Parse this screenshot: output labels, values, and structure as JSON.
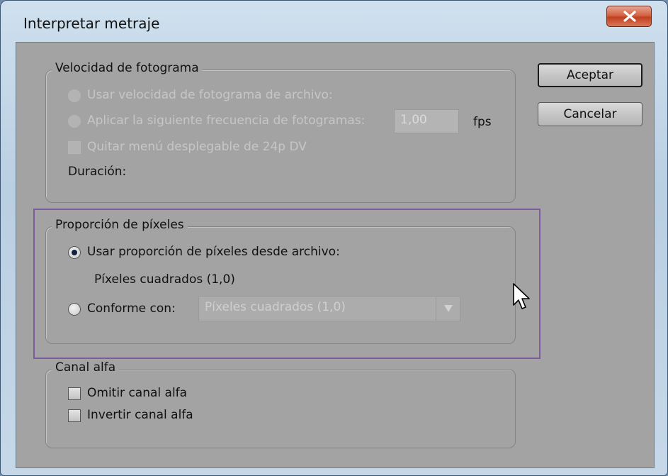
{
  "window": {
    "title": "Interpretar metraje"
  },
  "frame_rate": {
    "legend": "Velocidad de fotograma",
    "use_file_label": "Usar velocidad de fotograma de archivo:",
    "apply_label": "Aplicar la siguiente frecuencia de fotogramas:",
    "fps_value": "1,00",
    "fps_unit": "fps",
    "remove_pulldown_label": "Quitar menú desplegable de 24p DV",
    "duration_label": "Duración:"
  },
  "pixel_aspect": {
    "legend": "Proporción de píxeles",
    "use_file_label": "Usar proporción de píxeles desde archivo:",
    "file_value": "Píxeles cuadrados (1,0)",
    "conform_label": "Conforme con:",
    "conform_selected": "Píxeles cuadrados (1,0)"
  },
  "alpha": {
    "legend": "Canal alfa",
    "ignore_label": "Omitir canal alfa",
    "invert_label": "Invertir canal alfa"
  },
  "buttons": {
    "ok": "Aceptar",
    "cancel": "Cancelar"
  }
}
